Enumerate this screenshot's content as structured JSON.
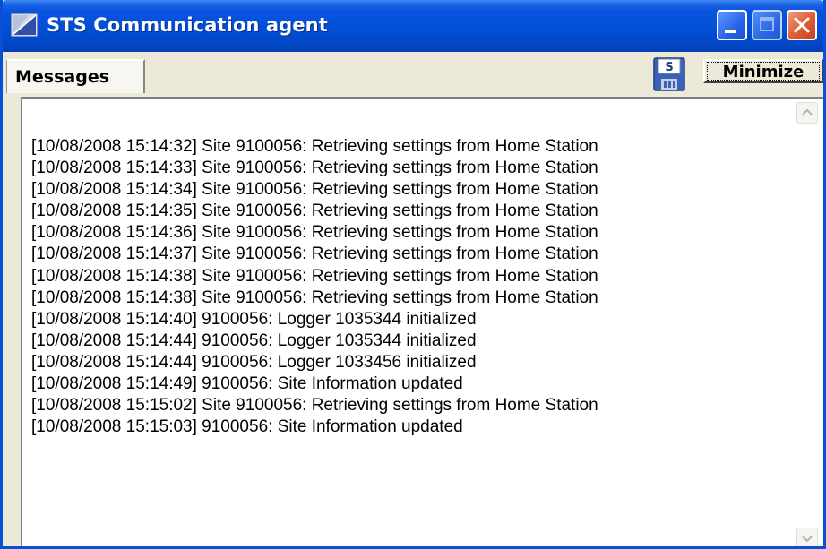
{
  "window": {
    "title": "STS Communication agent"
  },
  "tabs": [
    {
      "label": "Messages"
    }
  ],
  "toolbar": {
    "minimize_label": "Minimize",
    "save_icon_letter": "S"
  },
  "log": [
    "[10/08/2008 15:14:32] Site 9100056: Retrieving settings from Home Station",
    "[10/08/2008 15:14:33] Site 9100056: Retrieving settings from Home Station",
    "[10/08/2008 15:14:34] Site 9100056: Retrieving settings from Home Station",
    "[10/08/2008 15:14:35] Site 9100056: Retrieving settings from Home Station",
    "[10/08/2008 15:14:36] Site 9100056: Retrieving settings from Home Station",
    "[10/08/2008 15:14:37] Site 9100056: Retrieving settings from Home Station",
    "[10/08/2008 15:14:38] Site 9100056: Retrieving settings from Home Station",
    "[10/08/2008 15:14:38] Site 9100056: Retrieving settings from Home Station",
    "[10/08/2008 15:14:40] 9100056: Logger 1035344 initialized",
    "[10/08/2008 15:14:44] 9100056: Logger 1035344 initialized",
    "[10/08/2008 15:14:44] 9100056: Logger 1033456 initialized",
    "[10/08/2008 15:14:49] 9100056: Site Information updated",
    "[10/08/2008 15:15:02] Site 9100056: Retrieving settings from Home Station",
    "[10/08/2008 15:15:03] 9100056: Site Information updated"
  ],
  "colors": {
    "titlebar": "#0350d8",
    "window_face": "#ece9d8",
    "close_button": "#e06038"
  },
  "icons": {
    "app": "sts-app-icon",
    "save": "floppy-disk-icon",
    "minimize": "minimize-icon",
    "maximize": "maximize-icon",
    "close": "close-icon",
    "scroll_up": "chevron-up-icon",
    "scroll_down": "chevron-down-icon"
  }
}
